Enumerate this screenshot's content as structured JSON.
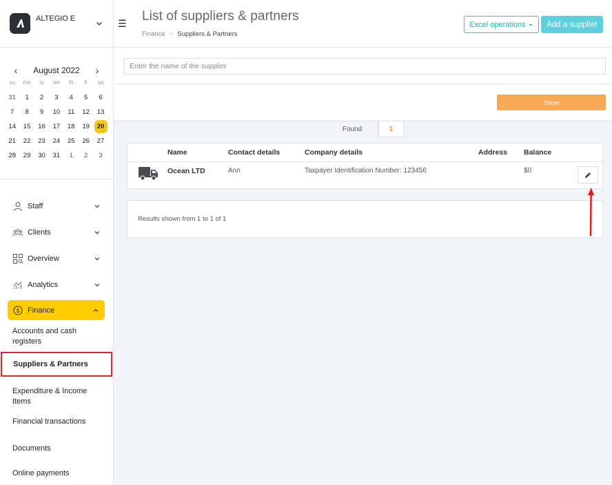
{
  "sidebar": {
    "company": "ALTEGIO E",
    "calendar": {
      "month_label": "August 2022",
      "weekdays": [
        "su",
        "mo",
        "tu",
        "we",
        "th",
        "fr",
        "sa"
      ],
      "weeks": [
        [
          "31",
          "1",
          "2",
          "3",
          "4",
          "5",
          "6"
        ],
        [
          "7",
          "8",
          "9",
          "10",
          "11",
          "12",
          "13"
        ],
        [
          "14",
          "15",
          "16",
          "17",
          "18",
          "19",
          "20"
        ],
        [
          "21",
          "22",
          "23",
          "24",
          "25",
          "26",
          "27"
        ],
        [
          "28",
          "29",
          "30",
          "31",
          "1",
          "2",
          "3"
        ]
      ],
      "today": "20"
    },
    "nav": {
      "staff": "Staff",
      "clients": "Clients",
      "overview": "Overview",
      "analytics": "Analytics",
      "finance": "Finance"
    },
    "finance_sub": {
      "accounts": "Accounts and cash registers",
      "suppliers": "Suppliers & Partners",
      "expenditure": "Expenditure & Income Items",
      "transactions": "Financial transactions",
      "documents": "Documents",
      "online_payments": "Online payments"
    }
  },
  "header": {
    "title": "List of suppliers & partners",
    "breadcrumb": [
      "Finance",
      "Suppliers & Partners"
    ],
    "breadcrumb_sep": ">",
    "excel_button": "Excel operations",
    "add_button": "Add a supplier"
  },
  "search": {
    "placeholder": "Enter the name of the supplier",
    "show_button": "Show"
  },
  "tabs": {
    "found_label": "Found",
    "count": "1"
  },
  "table": {
    "columns": {
      "name": "Name",
      "contact": "Contact details",
      "company": "Company details",
      "address": "Address",
      "balance": "Balance"
    },
    "rows": [
      {
        "name": "Ocean LTD",
        "contact": "Ann",
        "company": "Taxpayer Identification Number: 123456",
        "address": "",
        "balance": "$0"
      }
    ]
  },
  "results_text": "Results shown from 1 to 1 of 1",
  "colors": {
    "accent_yellow": "#ffcc00",
    "teal": "#5dd0dd",
    "orange": "#f7a954",
    "highlight_red": "#d9262e"
  }
}
